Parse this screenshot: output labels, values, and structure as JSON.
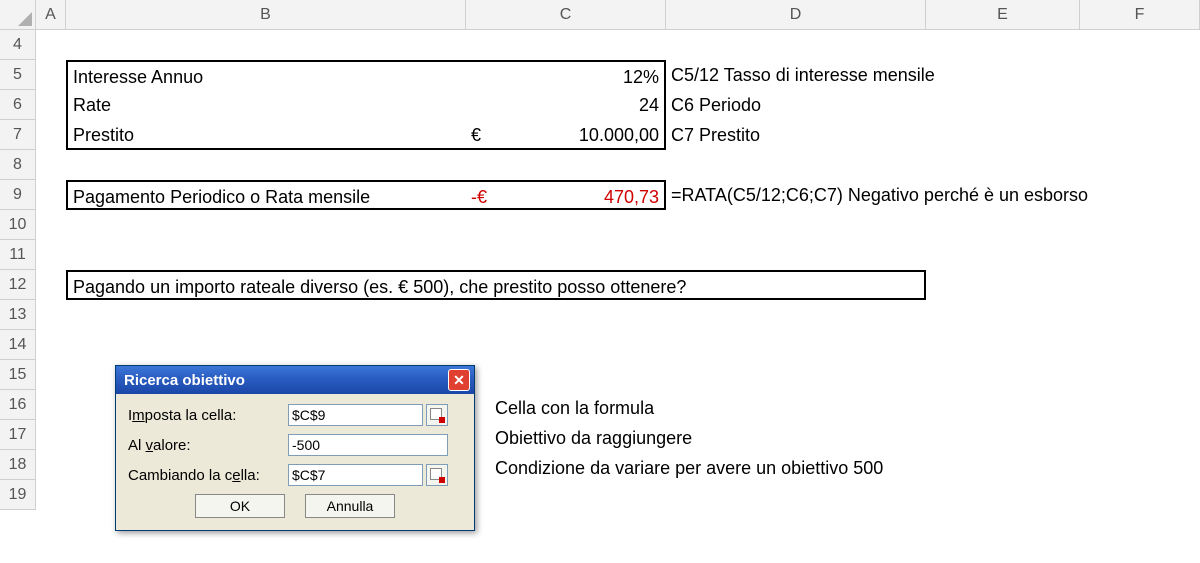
{
  "columns": [
    "A",
    "B",
    "C",
    "D",
    "E",
    "F"
  ],
  "rows": [
    "4",
    "5",
    "6",
    "7",
    "8",
    "9",
    "10",
    "11",
    "12",
    "13",
    "14",
    "15",
    "16",
    "17",
    "18",
    "19"
  ],
  "cells": {
    "b5": "Interesse Annuo",
    "c5": "12%",
    "d5": "C5/12 Tasso di interesse mensile",
    "b6": "Rate",
    "c6": "24",
    "d6": "C6 Periodo",
    "b7": "Prestito",
    "c7_cur": "€",
    "c7_val": "10.000,00",
    "d7": "C7 Prestito",
    "b9": "Pagamento Periodico o Rata mensile",
    "c9_cur": "-€",
    "c9_val": "470,73",
    "d9": "=RATA(C5/12;C6;C7) Negativo perché è un esborso",
    "b12": "Pagando un importo rateale diverso (es. € 500), che prestito posso ottenere?"
  },
  "dialog": {
    "title": "Ricerca obiettivo",
    "label1_pre": "I",
    "label1_u": "m",
    "label1_post": "posta la cella:",
    "input1": "$C$9",
    "label2_pre": "Al ",
    "label2_u": "v",
    "label2_post": "alore:",
    "input2": "-500",
    "label3_pre": "Cambiando la c",
    "label3_u": "e",
    "label3_post": "lla:",
    "input3": "$C$7",
    "ok": "OK",
    "cancel": "Annulla"
  },
  "annotations": {
    "a1": "Cella con la formula",
    "a2": "Obiettivo da raggiungere",
    "a3": "Condizione da variare per avere un obiettivo 500"
  }
}
